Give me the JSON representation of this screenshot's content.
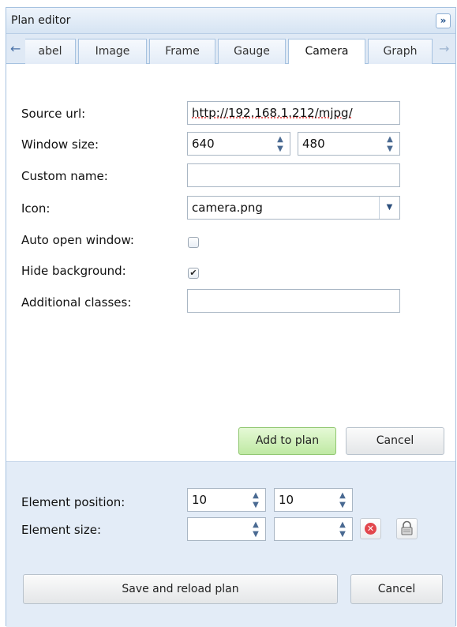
{
  "window": {
    "title": "Plan editor",
    "collapse_label": "»"
  },
  "tabs": [
    {
      "label": "abel",
      "active": false
    },
    {
      "label": "Image",
      "active": false
    },
    {
      "label": "Frame",
      "active": false
    },
    {
      "label": "Gauge",
      "active": false
    },
    {
      "label": "Camera",
      "active": true
    },
    {
      "label": "Graph",
      "active": false
    }
  ],
  "tab_arrows": {
    "left": "←",
    "right": "→"
  },
  "form": {
    "source_url": {
      "label": "Source url:",
      "value": "http://192.168.1.212/mjpg/"
    },
    "window_size": {
      "label": "Window size:",
      "width": "640",
      "height": "480"
    },
    "custom_name": {
      "label": "Custom name:",
      "value": ""
    },
    "icon": {
      "label": "Icon:",
      "value": "camera.png"
    },
    "auto_open_window": {
      "label": "Auto open window:",
      "checked": false
    },
    "hide_background": {
      "label": "Hide background:",
      "checked": true
    },
    "additional_classes": {
      "label": "Additional classes:",
      "value": ""
    }
  },
  "actions": {
    "add_to_plan": "Add to plan",
    "cancel": "Cancel"
  },
  "bottom": {
    "element_position": {
      "label": "Element position:",
      "x": "10",
      "y": "10"
    },
    "element_size": {
      "label": "Element size:",
      "w": "",
      "h": ""
    },
    "save_reload": "Save and reload plan",
    "cancel": "Cancel"
  },
  "colors": {
    "accent_border": "#a6c2e0",
    "add_button": "#bfe9a3",
    "remove_icon": "#e2474d"
  }
}
